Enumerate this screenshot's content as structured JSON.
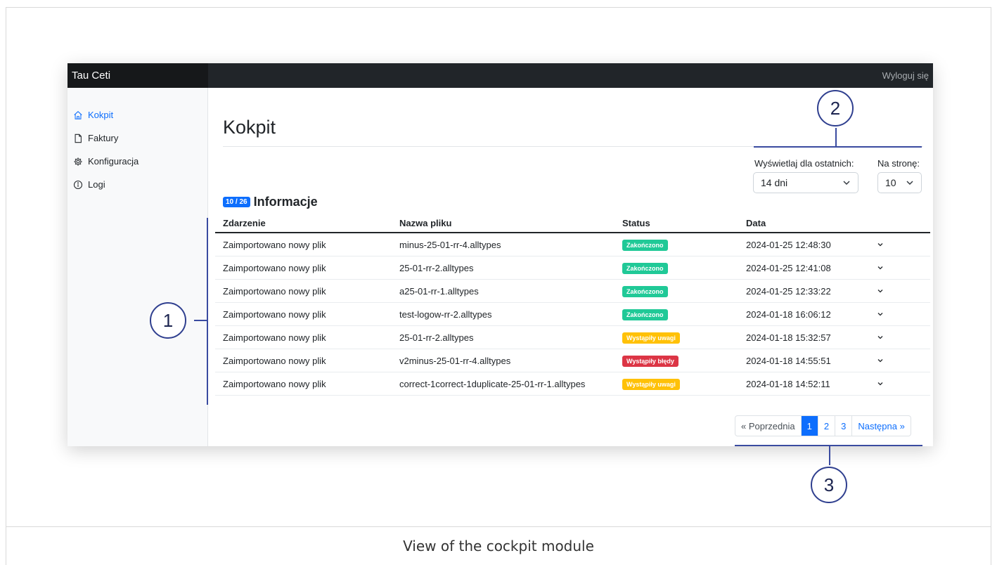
{
  "app": {
    "brand": "Tau Ceti",
    "logout": "Wyloguj się"
  },
  "sidebar": {
    "items": [
      {
        "label": "Kokpit",
        "icon": "home-icon",
        "active": true
      },
      {
        "label": "Faktury",
        "icon": "document-icon",
        "active": false
      },
      {
        "label": "Konfiguracja",
        "icon": "gear-icon",
        "active": false
      },
      {
        "label": "Logi",
        "icon": "info-icon",
        "active": false
      }
    ]
  },
  "page": {
    "title": "Kokpit"
  },
  "filters": {
    "period_label": "Wyświetlaj dla ostatnich:",
    "period_value": "14 dni",
    "per_page_label": "Na stronę:",
    "per_page_value": "10"
  },
  "info": {
    "count": "10 / 26",
    "title": "Informacje"
  },
  "table": {
    "headers": [
      "Zdarzenie",
      "Nazwa pliku",
      "Status",
      "Data"
    ],
    "rows": [
      {
        "event": "Zaimportowano nowy plik",
        "file": "minus-25-01-rr-4.alltypes",
        "status": "Zakończono",
        "status_color": "#20c997",
        "date": "2024-01-25 12:48:30"
      },
      {
        "event": "Zaimportowano nowy plik",
        "file": "25-01-rr-2.alltypes",
        "status": "Zakończono",
        "status_color": "#20c997",
        "date": "2024-01-25 12:41:08"
      },
      {
        "event": "Zaimportowano nowy plik",
        "file": "a25-01-rr-1.alltypes",
        "status": "Zakończono",
        "status_color": "#20c997",
        "date": "2024-01-25 12:33:22"
      },
      {
        "event": "Zaimportowano nowy plik",
        "file": "test-logow-rr-2.alltypes",
        "status": "Zakończono",
        "status_color": "#20c997",
        "date": "2024-01-18 16:06:12"
      },
      {
        "event": "Zaimportowano nowy plik",
        "file": "25-01-rr-2.alltypes",
        "status": "Wystąpiły uwagi",
        "status_color": "#ffc107",
        "date": "2024-01-18 15:32:57"
      },
      {
        "event": "Zaimportowano nowy plik",
        "file": "v2minus-25-01-rr-4.alltypes",
        "status": "Wystąpiły błędy",
        "status_color": "#dc3545",
        "date": "2024-01-18 14:55:51"
      },
      {
        "event": "Zaimportowano nowy plik",
        "file": "correct-1correct-1duplicate-25-01-rr-1.alltypes",
        "status": "Wystąpiły uwagi",
        "status_color": "#ffc107",
        "date": "2024-01-18 14:52:11"
      }
    ]
  },
  "pagination": {
    "prev": "« Poprzednia",
    "pages": [
      "1",
      "2",
      "3"
    ],
    "active": "1",
    "next": "Następna »"
  },
  "callouts": [
    "1",
    "2",
    "3"
  ],
  "caption": "View of the cockpit module"
}
